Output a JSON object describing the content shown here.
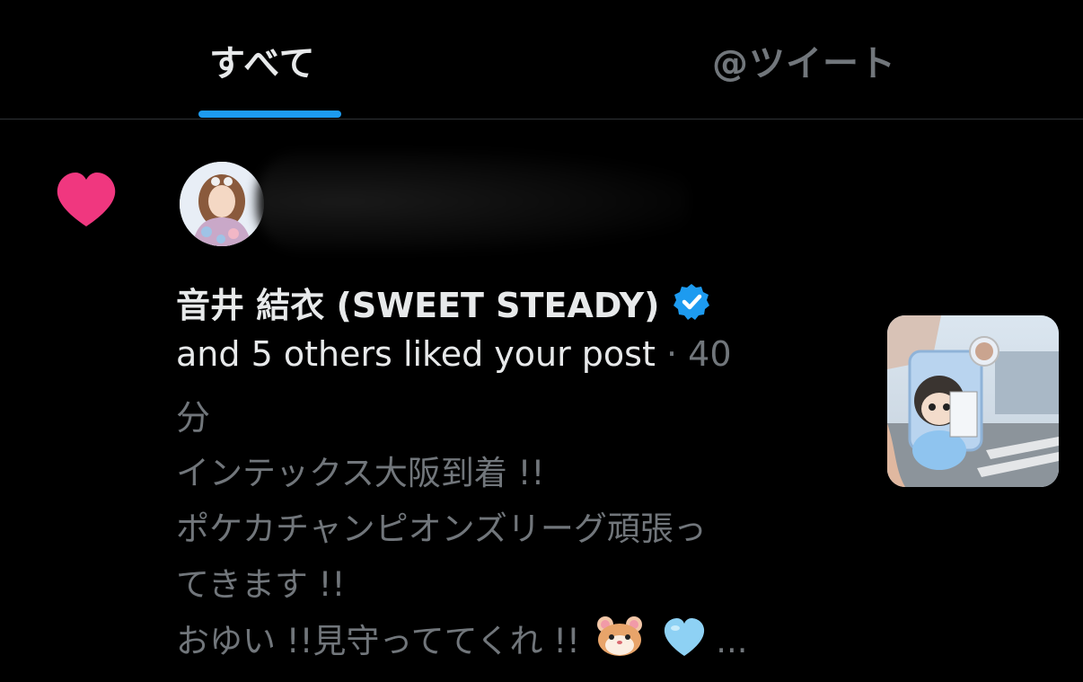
{
  "tabs": {
    "all": "すべて",
    "mentions": "@ツイート"
  },
  "notification": {
    "user_name": "音井 結衣 (SWEET STEADY)",
    "action": "and 5 others liked your post",
    "separator": "·",
    "time_number": "40",
    "time_unit": "分",
    "post_lines": [
      "インテックス大阪到着 !!",
      "ポケカチャンピオンズリーグ頑張っ",
      "てきます !!",
      "おゆい !!見守っててくれ !!"
    ],
    "ellipsis": "...",
    "icons": {
      "like": "heart-icon",
      "verified": "verified-badge-icon",
      "emoji1": "hamster-emoji",
      "emoji2": "blue-heart-emoji"
    },
    "colors": {
      "like": "#f0377f",
      "verified": "#1d9bf0",
      "tab_indicator": "#1d9bf0"
    }
  }
}
